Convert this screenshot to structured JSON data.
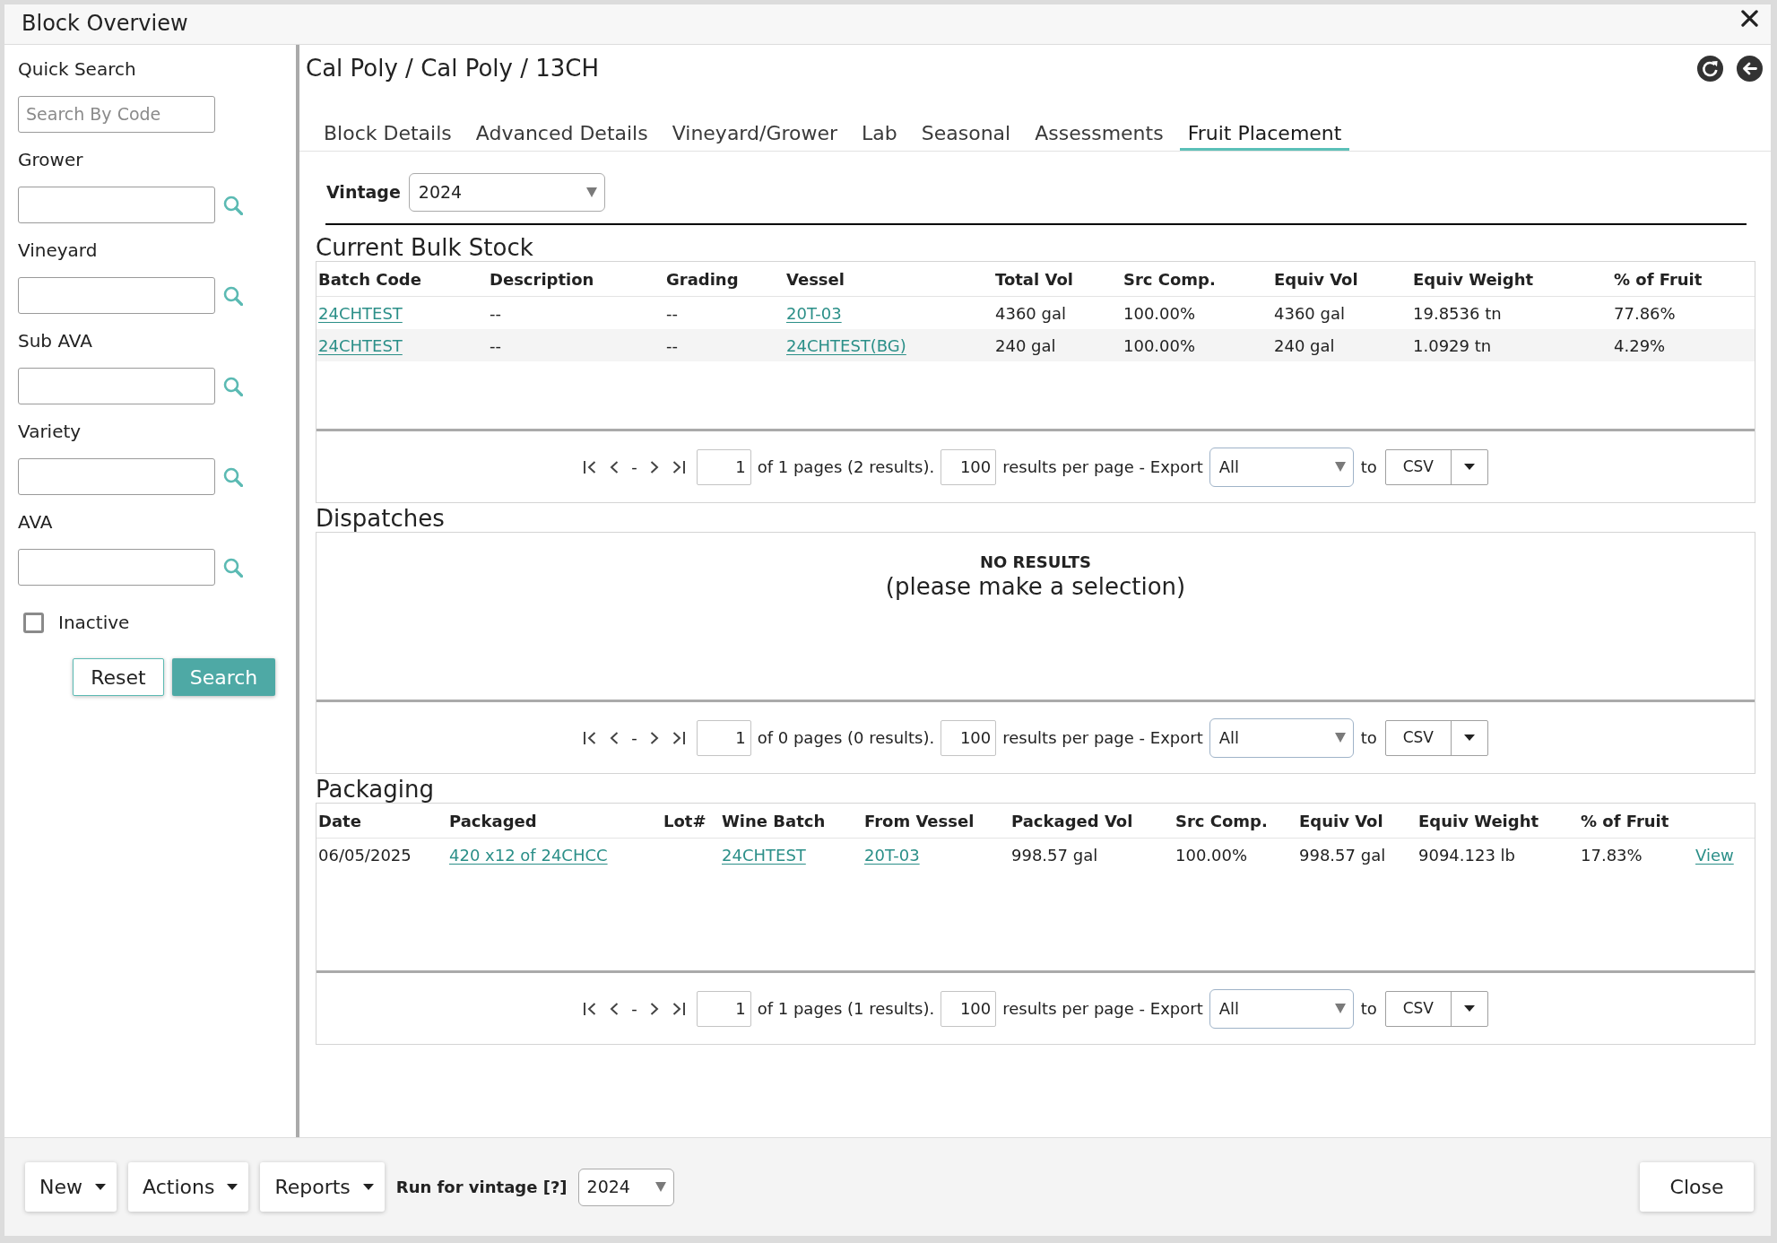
{
  "window": {
    "title": "Block Overview"
  },
  "sidebar": {
    "quick_search": {
      "label": "Quick Search",
      "placeholder": "Search By Code"
    },
    "lookups": [
      {
        "label": "Grower"
      },
      {
        "label": "Vineyard"
      },
      {
        "label": "Sub AVA"
      },
      {
        "label": "Variety"
      },
      {
        "label": "AVA"
      }
    ],
    "inactive": {
      "label": "Inactive",
      "checked": false
    },
    "buttons": [
      {
        "label": "Reset",
        "kind": "secondary"
      },
      {
        "label": "Search",
        "kind": "primary"
      }
    ]
  },
  "breadcrumb": "Cal Poly / Cal Poly / 13CH",
  "tabs": [
    {
      "label": "Block Details",
      "selected": false
    },
    {
      "label": "Advanced Details",
      "selected": false
    },
    {
      "label": "Vineyard/Grower",
      "selected": false
    },
    {
      "label": "Lab",
      "selected": false
    },
    {
      "label": "Seasonal",
      "selected": false
    },
    {
      "label": "Assessments",
      "selected": false
    },
    {
      "label": "Fruit Placement",
      "selected": true
    }
  ],
  "vintage": {
    "label": "Vintage",
    "value": "2024"
  },
  "sections": [
    {
      "kind": "table",
      "title": "Current Bulk Stock",
      "columns": [
        "Batch Code",
        "Description",
        "Grading",
        "Vessel",
        "Total Vol",
        "Src Comp.",
        "Equiv Vol",
        "Equiv Weight",
        "% of Fruit"
      ],
      "rows": [
        [
          {
            "text": "24CHTEST",
            "kind": "link"
          },
          {
            "text": "--",
            "kind": "text"
          },
          {
            "text": "--",
            "kind": "text"
          },
          {
            "text": "20T-03",
            "kind": "link"
          },
          {
            "text": "4360 gal",
            "kind": "text"
          },
          {
            "text": "100.00%",
            "kind": "text"
          },
          {
            "text": "4360 gal",
            "kind": "text"
          },
          {
            "text": "19.8536 tn",
            "kind": "text"
          },
          {
            "text": "77.86%",
            "kind": "text"
          }
        ],
        [
          {
            "text": "24CHTEST",
            "kind": "link"
          },
          {
            "text": "--",
            "kind": "text"
          },
          {
            "text": "--",
            "kind": "text"
          },
          {
            "text": "24CHTEST(BG)",
            "kind": "link"
          },
          {
            "text": "240 gal",
            "kind": "text"
          },
          {
            "text": "100.00%",
            "kind": "text"
          },
          {
            "text": "240 gal",
            "kind": "text"
          },
          {
            "text": "1.0929 tn",
            "kind": "text"
          },
          {
            "text": "4.29%",
            "kind": "text"
          }
        ]
      ],
      "pager": {
        "separator": "-",
        "page": "1",
        "summary": "of 1 pages (2 results).",
        "per_page": "100",
        "per_page_label": "results per page - Export",
        "export_scope": "All",
        "to_label": "to",
        "format": "CSV"
      }
    },
    {
      "kind": "empty",
      "title": "Dispatches",
      "message": "NO RESULTS",
      "hint": "(please make a selection)",
      "pager": {
        "separator": "-",
        "page": "1",
        "summary": "of 0 pages (0 results).",
        "per_page": "100",
        "per_page_label": "results per page - Export",
        "export_scope": "All",
        "to_label": "to",
        "format": "CSV"
      }
    },
    {
      "kind": "table",
      "title": "Packaging",
      "columns": [
        "Date",
        "Packaged",
        "Lot#",
        "Wine Batch",
        "From Vessel",
        "Packaged Vol",
        "Src Comp.",
        "Equiv Vol",
        "Equiv Weight",
        "% of Fruit"
      ],
      "rows": [
        [
          {
            "text": "06/05/2025",
            "kind": "text"
          },
          {
            "text": "420 x12 of 24CHCC",
            "kind": "link"
          },
          {
            "kind": "blank"
          },
          {
            "text": "24CHTEST",
            "kind": "link"
          },
          {
            "text": "20T-03",
            "kind": "link"
          },
          {
            "text": "998.57 gal",
            "kind": "text"
          },
          {
            "text": "100.00%",
            "kind": "text"
          },
          {
            "text": "998.57 gal",
            "kind": "text"
          },
          {
            "text": "9094.123 lb",
            "kind": "text"
          },
          {
            "text": "17.83%",
            "kind": "text"
          },
          {
            "text": "View",
            "kind": "link"
          }
        ]
      ],
      "pager": {
        "separator": "-",
        "page": "1",
        "summary": "of 1 pages (1 results).",
        "per_page": "100",
        "per_page_label": "results per page - Export",
        "export_scope": "All",
        "to_label": "to",
        "format": "CSV"
      }
    }
  ],
  "footer": {
    "menus": [
      {
        "label": "New"
      },
      {
        "label": "Actions"
      },
      {
        "label": "Reports"
      }
    ],
    "run_for_vintage": {
      "label": "Run for vintage [?]",
      "value": "2024"
    },
    "close": "Close"
  }
}
